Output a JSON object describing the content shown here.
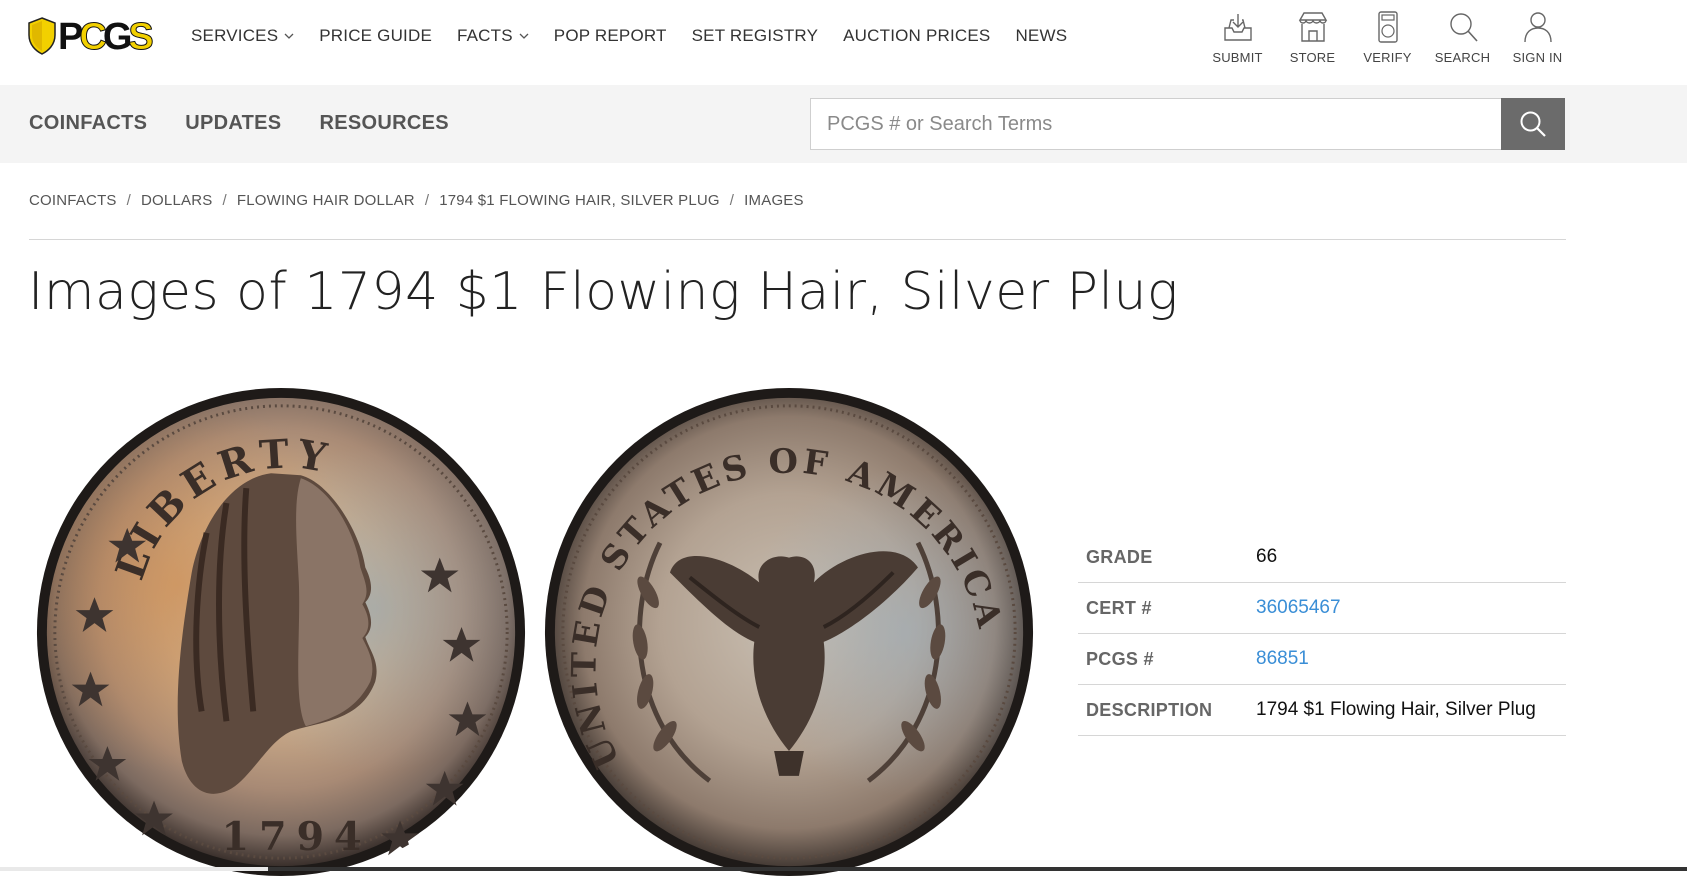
{
  "header": {
    "logo_text": "PCGS",
    "nav": [
      {
        "label": "SERVICES",
        "dropdown": true
      },
      {
        "label": "PRICE GUIDE",
        "dropdown": false
      },
      {
        "label": "FACTS",
        "dropdown": true
      },
      {
        "label": "POP REPORT",
        "dropdown": false
      },
      {
        "label": "SET REGISTRY",
        "dropdown": false
      },
      {
        "label": "AUCTION PRICES",
        "dropdown": false
      },
      {
        "label": "NEWS",
        "dropdown": false
      }
    ],
    "tools": [
      {
        "label": "SUBMIT",
        "icon": "submit-tray-icon"
      },
      {
        "label": "STORE",
        "icon": "store-icon"
      },
      {
        "label": "VERIFY",
        "icon": "verify-slab-icon"
      },
      {
        "label": "SEARCH",
        "icon": "search-icon"
      },
      {
        "label": "SIGN IN",
        "icon": "user-icon"
      }
    ]
  },
  "subnav": {
    "items": [
      "COINFACTS",
      "UPDATES",
      "RESOURCES"
    ],
    "search_placeholder": "PCGS # or Search Terms"
  },
  "breadcrumb": [
    "COINFACTS",
    "DOLLARS",
    "FLOWING HAIR DOLLAR",
    "1794 $1 FLOWING HAIR, SILVER PLUG",
    "IMAGES"
  ],
  "page_title": "Images of 1794 $1 Flowing Hair, Silver Plug",
  "coin": {
    "obverse_legend": "LIBERTY",
    "obverse_date": "1794",
    "reverse_legend": "UNITED STATES OF AMERICA"
  },
  "details": {
    "grade_label": "GRADE",
    "grade": "66",
    "cert_label": "CERT #",
    "cert": "36065467",
    "pcgs_label": "PCGS #",
    "pcgs": "86851",
    "description_label": "DESCRIPTION",
    "description": "1794 $1 Flowing Hair, Silver Plug"
  },
  "colors": {
    "brand_yellow": "#f2d000",
    "link": "#3a8ed6",
    "subbar": "#f4f4f4",
    "search_button": "#6b6b6b"
  }
}
